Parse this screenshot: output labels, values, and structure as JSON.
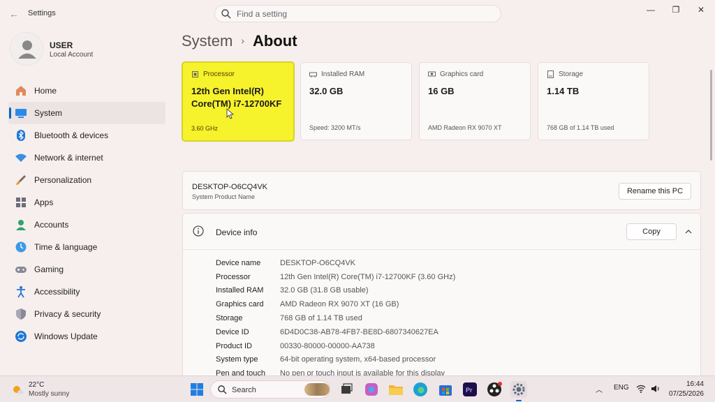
{
  "window": {
    "app_title": "Settings",
    "search_placeholder": "Find a setting",
    "minimize": "—",
    "maximize": "❐",
    "close": "✕"
  },
  "user": {
    "name": "USER",
    "account_type": "Local Account"
  },
  "sidebar": {
    "items": [
      {
        "label": "Home",
        "icon": "home-icon"
      },
      {
        "label": "System",
        "icon": "system-icon",
        "active": true
      },
      {
        "label": "Bluetooth & devices",
        "icon": "bluetooth-icon"
      },
      {
        "label": "Network & internet",
        "icon": "network-icon"
      },
      {
        "label": "Personalization",
        "icon": "personalization-icon"
      },
      {
        "label": "Apps",
        "icon": "apps-icon"
      },
      {
        "label": "Accounts",
        "icon": "accounts-icon"
      },
      {
        "label": "Time & language",
        "icon": "time-language-icon"
      },
      {
        "label": "Gaming",
        "icon": "gaming-icon"
      },
      {
        "label": "Accessibility",
        "icon": "accessibility-icon"
      },
      {
        "label": "Privacy & security",
        "icon": "privacy-icon"
      },
      {
        "label": "Windows Update",
        "icon": "windows-update-icon"
      }
    ]
  },
  "breadcrumb": {
    "parent": "System",
    "separator": "›",
    "current": "About"
  },
  "specs": [
    {
      "title": "Processor",
      "value": "12th Gen Intel(R) Core(TM) i7-12700KF",
      "sub": "3.60 GHz",
      "highlighted": true
    },
    {
      "title": "Installed RAM",
      "value": "32.0 GB",
      "sub": "Speed: 3200 MT/s"
    },
    {
      "title": "Graphics card",
      "value": "16 GB",
      "sub": "AMD Radeon RX 9070 XT"
    },
    {
      "title": "Storage",
      "value": "1.14 TB",
      "sub": "768 GB of 1.14 TB used"
    }
  ],
  "pc": {
    "name": "DESKTOP-O6CQ4VK",
    "label": "System Product Name",
    "rename_button": "Rename this PC"
  },
  "device_info": {
    "title": "Device info",
    "copy_button": "Copy",
    "rows": [
      {
        "key": "Device name",
        "value": "DESKTOP-O6CQ4VK"
      },
      {
        "key": "Processor",
        "value": "12th Gen Intel(R) Core(TM) i7-12700KF (3.60 GHz)"
      },
      {
        "key": "Installed RAM",
        "value": "32.0 GB (31.8 GB usable)"
      },
      {
        "key": "Graphics card",
        "value": "AMD Radeon RX 9070 XT (16 GB)"
      },
      {
        "key": "Storage",
        "value": "768 GB of 1.14 TB used"
      },
      {
        "key": "Device ID",
        "value": "6D4D0C38-AB78-4FB7-BE8D-6807340627EA"
      },
      {
        "key": "Product ID",
        "value": "00330-80000-00000-AA738"
      },
      {
        "key": "System type",
        "value": "64-bit operating system, x64-based processor"
      },
      {
        "key": "Pen and touch",
        "value": "No pen or touch input is available for this display"
      }
    ]
  },
  "taskbar": {
    "weather_temp": "22°C",
    "weather_desc": "Mostly sunny",
    "search_label": "Search",
    "language": "ENG",
    "time": "16:44",
    "date": "07/25/2026"
  },
  "colors": {
    "accent": "#0067c0",
    "highlight": "#f6f22c",
    "background": "#f7efee"
  }
}
